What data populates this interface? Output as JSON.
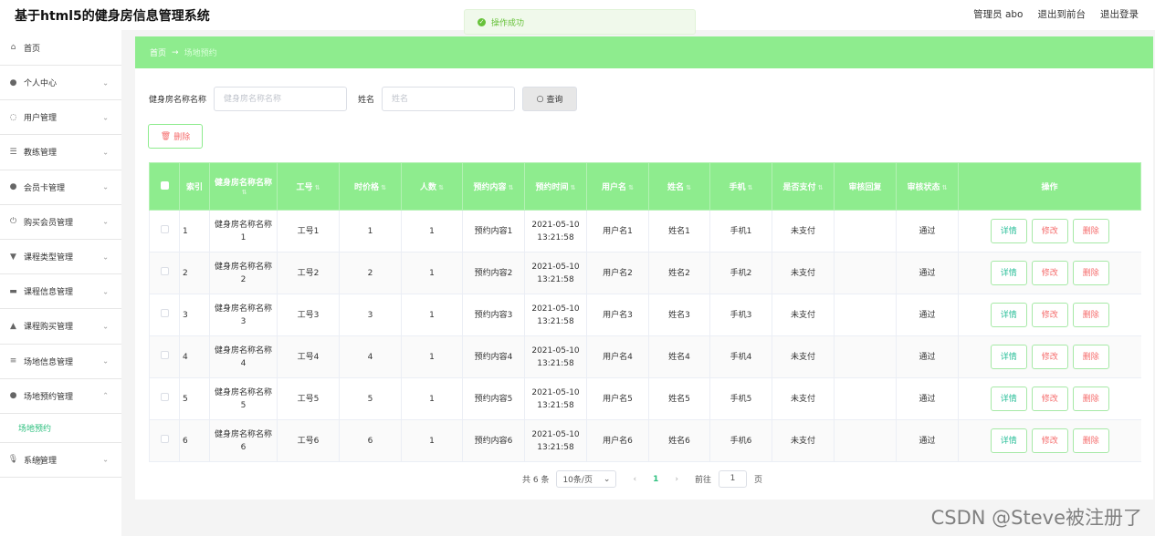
{
  "header": {
    "title": "基于html5的健身房信息管理系统",
    "user": "管理员 abo",
    "back_to_front": "退出到前台",
    "logout": "退出登录"
  },
  "toast": {
    "message": "操作成功",
    "color": "#67c23a"
  },
  "sidebar": {
    "items": [
      {
        "label": "首页",
        "icon": "home-icon",
        "glyph": "⌂",
        "arrow": ""
      },
      {
        "label": "个人中心",
        "icon": "user-icon",
        "glyph": "●",
        "arrow": "⌄"
      },
      {
        "label": "用户管理",
        "icon": "users-icon",
        "glyph": "◌",
        "arrow": "⌄"
      },
      {
        "label": "教练管理",
        "icon": "sliders-icon",
        "glyph": "☰",
        "arrow": "⌄"
      },
      {
        "label": "会员卡管理",
        "icon": "member-icon",
        "glyph": "●",
        "arrow": "⌄"
      },
      {
        "label": "购买会员管理",
        "icon": "power-icon",
        "glyph": "⏻",
        "arrow": "⌄"
      },
      {
        "label": "课程类型管理",
        "icon": "trophy-icon",
        "glyph": "▼",
        "arrow": "⌄"
      },
      {
        "label": "课程信息管理",
        "icon": "chart-icon",
        "glyph": "▬",
        "arrow": "⌄"
      },
      {
        "label": "课程购买管理",
        "icon": "house-icon",
        "glyph": "▲",
        "arrow": "⌄"
      },
      {
        "label": "场地信息管理",
        "icon": "list-icon",
        "glyph": "≡",
        "arrow": "⌄"
      },
      {
        "label": "场地预约管理",
        "icon": "calendar-icon",
        "glyph": "●",
        "arrow": "⌃"
      }
    ],
    "submenu": "场地预约",
    "last_item": {
      "label": "系统管理",
      "icon": "mic-icon",
      "glyph": "🎙",
      "arrow": "⌄"
    }
  },
  "breadcrumb": {
    "home": "首页",
    "separator": "→",
    "current": "场地预约"
  },
  "search": {
    "name_label": "健身房名称名称",
    "name_placeholder": "健身房名称名称",
    "person_label": "姓名",
    "person_placeholder": "姓名",
    "button": "查询"
  },
  "delete_button": "删除",
  "table": {
    "headers": [
      "索引",
      "健身房名称名称",
      "工号",
      "时价格",
      "人数",
      "预约内容",
      "预约时间",
      "用户名",
      "姓名",
      "手机",
      "是否支付",
      "审核回复",
      "审核状态",
      "操作"
    ],
    "rows": [
      {
        "idx": "1",
        "name": "健身房名称名称1",
        "no": "工号1",
        "price": "1",
        "count": "1",
        "content": "预约内容1",
        "time": "2021-05-10 13:21:58",
        "username": "用户名1",
        "person": "姓名1",
        "phone": "手机1",
        "paid": "未支付",
        "reply": "",
        "status": "通过"
      },
      {
        "idx": "2",
        "name": "健身房名称名称2",
        "no": "工号2",
        "price": "2",
        "count": "1",
        "content": "预约内容2",
        "time": "2021-05-10 13:21:58",
        "username": "用户名2",
        "person": "姓名2",
        "phone": "手机2",
        "paid": "未支付",
        "reply": "",
        "status": "通过"
      },
      {
        "idx": "3",
        "name": "健身房名称名称3",
        "no": "工号3",
        "price": "3",
        "count": "1",
        "content": "预约内容3",
        "time": "2021-05-10 13:21:58",
        "username": "用户名3",
        "person": "姓名3",
        "phone": "手机3",
        "paid": "未支付",
        "reply": "",
        "status": "通过"
      },
      {
        "idx": "4",
        "name": "健身房名称名称4",
        "no": "工号4",
        "price": "4",
        "count": "1",
        "content": "预约内容4",
        "time": "2021-05-10 13:21:58",
        "username": "用户名4",
        "person": "姓名4",
        "phone": "手机4",
        "paid": "未支付",
        "reply": "",
        "status": "通过"
      },
      {
        "idx": "5",
        "name": "健身房名称名称5",
        "no": "工号5",
        "price": "5",
        "count": "1",
        "content": "预约内容5",
        "time": "2021-05-10 13:21:58",
        "username": "用户名5",
        "person": "姓名5",
        "phone": "手机5",
        "paid": "未支付",
        "reply": "",
        "status": "通过"
      },
      {
        "idx": "6",
        "name": "健身房名称名称6",
        "no": "工号6",
        "price": "6",
        "count": "1",
        "content": "预约内容6",
        "time": "2021-05-10 13:21:58",
        "username": "用户名6",
        "person": "姓名6",
        "phone": "手机6",
        "paid": "未支付",
        "reply": "",
        "status": "通过"
      }
    ],
    "actions": {
      "detail": "详情",
      "edit": "修改",
      "remove": "删除"
    }
  },
  "pagination": {
    "total": "共 6 条",
    "page_size": "10条/页",
    "current_page": "1",
    "goto_label": "前往",
    "goto_value": "1",
    "page_unit": "页"
  },
  "watermark": "CSDN @Steve被注册了",
  "colors": {
    "accent": "#8eec8e",
    "link": "#2bbf7d",
    "danger": "#f56c6c"
  }
}
